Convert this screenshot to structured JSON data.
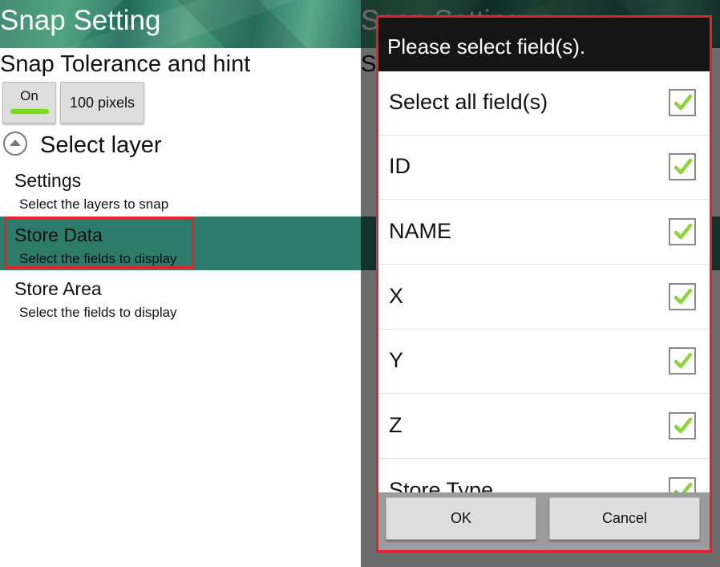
{
  "left": {
    "title": "Snap Setting",
    "tolerance_title": "Snap Tolerance and hint",
    "toggle_label": "On",
    "tolerance_value": "100 pixels",
    "layer_section": "Select layer",
    "items": [
      {
        "title": "Settings",
        "subtitle": "Select the layers to snap"
      },
      {
        "title": "Store Data",
        "subtitle": "Select the fields to display"
      },
      {
        "title": "Store Area",
        "subtitle": "Select the fields to display"
      }
    ]
  },
  "dialog": {
    "title": "Please select field(s).",
    "rows": [
      {
        "label": "Select all field(s)",
        "checked": true
      },
      {
        "label": "ID",
        "checked": true
      },
      {
        "label": "NAME",
        "checked": true
      },
      {
        "label": "X",
        "checked": true
      },
      {
        "label": "Y",
        "checked": true
      },
      {
        "label": "Z",
        "checked": true
      },
      {
        "label": "Store Type",
        "checked": true
      }
    ],
    "ok_label": "OK",
    "cancel_label": "Cancel"
  },
  "colors": {
    "accent_green": "#7bd81e",
    "selected_row": "#2d7b6a",
    "highlight_red": "#e3222b",
    "check_green": "#8cd43a"
  }
}
